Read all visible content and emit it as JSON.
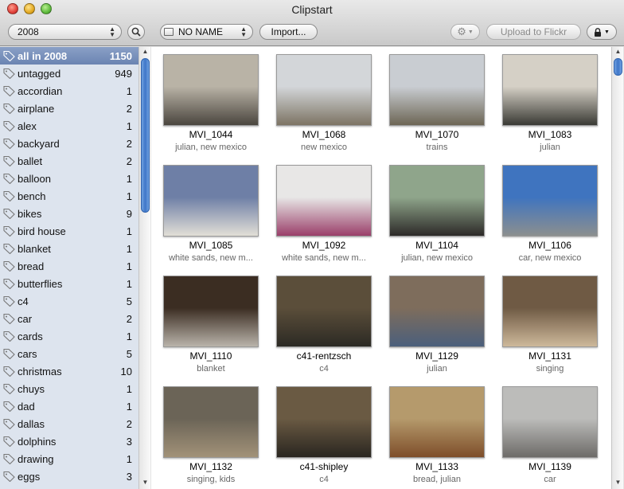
{
  "window": {
    "title": "Clipstart"
  },
  "toolbar": {
    "year_select": "2008",
    "device_select": "NO NAME",
    "import_label": "Import...",
    "upload_label": "Upload to Flickr"
  },
  "sidebar": {
    "items": [
      {
        "label": "all in 2008",
        "count": "1150",
        "selected": true
      },
      {
        "label": "untagged",
        "count": "949"
      },
      {
        "label": "accordian",
        "count": "1"
      },
      {
        "label": "airplane",
        "count": "2"
      },
      {
        "label": "alex",
        "count": "1"
      },
      {
        "label": "backyard",
        "count": "2"
      },
      {
        "label": "ballet",
        "count": "2"
      },
      {
        "label": "balloon",
        "count": "1"
      },
      {
        "label": "bench",
        "count": "1"
      },
      {
        "label": "bikes",
        "count": "9"
      },
      {
        "label": "bird house",
        "count": "1"
      },
      {
        "label": "blanket",
        "count": "1"
      },
      {
        "label": "bread",
        "count": "1"
      },
      {
        "label": "butterflies",
        "count": "1"
      },
      {
        "label": "c4",
        "count": "5"
      },
      {
        "label": "car",
        "count": "2"
      },
      {
        "label": "cards",
        "count": "1"
      },
      {
        "label": "cars",
        "count": "5"
      },
      {
        "label": "christmas",
        "count": "10"
      },
      {
        "label": "chuys",
        "count": "1"
      },
      {
        "label": "dad",
        "count": "1"
      },
      {
        "label": "dallas",
        "count": "2"
      },
      {
        "label": "dolphins",
        "count": "3"
      },
      {
        "label": "drawing",
        "count": "1"
      },
      {
        "label": "eggs",
        "count": "3"
      }
    ]
  },
  "clips": [
    {
      "title": "MVI_1044",
      "tags": "julian, new mexico",
      "sky": "#b9b3a6",
      "ground": "#4b463f"
    },
    {
      "title": "MVI_1068",
      "tags": "new mexico",
      "sky": "#d3d6d9",
      "ground": "#7d7464"
    },
    {
      "title": "MVI_1070",
      "tags": "trains",
      "sky": "#c9cdd2",
      "ground": "#6d6655"
    },
    {
      "title": "MVI_1083",
      "tags": "julian",
      "sky": "#d5d0c6",
      "ground": "#3a3a34"
    },
    {
      "title": "MVI_1085",
      "tags": "white sands, new m...",
      "sky": "#6e7fa6",
      "ground": "#e2dfd6"
    },
    {
      "title": "MVI_1092",
      "tags": "white sands, new m...",
      "sky": "#e8e7e6",
      "ground": "#9a3f6a"
    },
    {
      "title": "MVI_1104",
      "tags": "julian, new mexico",
      "sky": "#8fa58b",
      "ground": "#2d2a28"
    },
    {
      "title": "MVI_1106",
      "tags": "car, new mexico",
      "sky": "#3f74bf",
      "ground": "#8c8f8f"
    },
    {
      "title": "MVI_1110",
      "tags": "blanket",
      "sky": "#3b2d22",
      "ground": "#b9b3aa"
    },
    {
      "title": "c41-rentzsch",
      "tags": "c4",
      "sky": "#5b4e3a",
      "ground": "#2c2a24"
    },
    {
      "title": "MVI_1129",
      "tags": "julian",
      "sky": "#7e6d5c",
      "ground": "#4b5f7c"
    },
    {
      "title": "MVI_1131",
      "tags": "singing",
      "sky": "#6f5a44",
      "ground": "#cdb89a"
    },
    {
      "title": "MVI_1132",
      "tags": "singing, kids",
      "sky": "#6b6457",
      "ground": "#a29278"
    },
    {
      "title": "c41-shipley",
      "tags": "c4",
      "sky": "#6a5a43",
      "ground": "#2a2620"
    },
    {
      "title": "MVI_1133",
      "tags": "bread, julian",
      "sky": "#b59a6c",
      "ground": "#7e4e2a"
    },
    {
      "title": "MVI_1139",
      "tags": "car",
      "sky": "#bcbcba",
      "ground": "#6d6b68"
    }
  ]
}
